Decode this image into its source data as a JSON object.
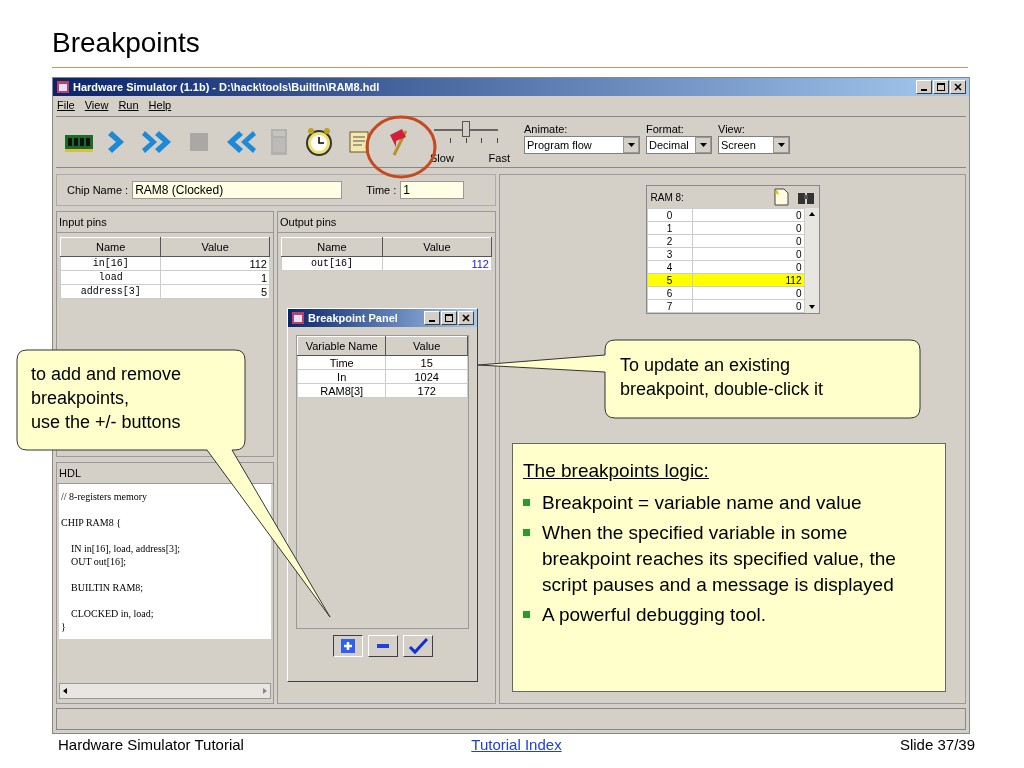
{
  "slide": {
    "title": "Breakpoints"
  },
  "window": {
    "title": "Hardware Simulator (1.1b) - D:\\hack\\tools\\BuiltIn\\RAM8.hdl"
  },
  "menu": [
    {
      "label": "File"
    },
    {
      "label": "View"
    },
    {
      "label": "Run"
    },
    {
      "label": "Help"
    }
  ],
  "toolbar": {
    "buttons": [
      {
        "kind": "chip",
        "disabled": false
      },
      {
        "kind": "step",
        "disabled": false
      },
      {
        "kind": "fast_forward",
        "disabled": false
      },
      {
        "kind": "stop",
        "disabled": true
      },
      {
        "kind": "rewind",
        "disabled": false
      },
      {
        "kind": "calculator",
        "disabled": true
      },
      {
        "kind": "clock",
        "disabled": false
      },
      {
        "kind": "script",
        "disabled": false
      },
      {
        "kind": "breakpoints",
        "disabled": false
      }
    ],
    "speed": {
      "level": 0.5,
      "min_label": "Slow",
      "max_label": "Fast"
    },
    "dropdowns": [
      {
        "label": "Animate:",
        "value": "Program flow"
      },
      {
        "label": "Format:",
        "value": "Decimal"
      },
      {
        "label": "View:",
        "value": "Screen"
      }
    ]
  },
  "chip": {
    "name_label": "Chip Name :",
    "name": "RAM8 (Clocked)",
    "time_label": "Time :",
    "time": "1"
  },
  "input_pins": {
    "title": "Input pins",
    "columns": [
      "Name",
      "Value"
    ],
    "rows": [
      {
        "name": "in[16]",
        "value": "112"
      },
      {
        "name": "load",
        "value": "1"
      },
      {
        "name": "address[3]",
        "value": "5"
      }
    ]
  },
  "output_pins": {
    "title": "Output pins",
    "columns": [
      "Name",
      "Value"
    ],
    "rows": [
      {
        "name": "out[16]",
        "value": "112"
      }
    ]
  },
  "hdl": {
    "title": "HDL",
    "lines": [
      {
        "text": "// 8-registers memory",
        "indented": false,
        "gap_before": false
      },
      {
        "text": "CHIP RAM8 {",
        "indented": false,
        "gap_before": true
      },
      {
        "text": "IN in[16], load, address[3];",
        "indented": true,
        "gap_before": true
      },
      {
        "text": "OUT out[16];",
        "indented": true,
        "gap_before": false
      },
      {
        "text": "BUILTIN RAM8;",
        "indented": true,
        "gap_before": true
      },
      {
        "text": "CLOCKED in, load;",
        "indented": true,
        "gap_before": true
      },
      {
        "text": "}",
        "indented": false,
        "gap_before": false
      }
    ]
  },
  "ram": {
    "title": "RAM 8:",
    "rows": [
      {
        "address": "0",
        "value": "0",
        "selected": false
      },
      {
        "address": "1",
        "value": "0",
        "selected": false
      },
      {
        "address": "2",
        "value": "0",
        "selected": false
      },
      {
        "address": "3",
        "value": "0",
        "selected": false
      },
      {
        "address": "4",
        "value": "0",
        "selected": false
      },
      {
        "address": "5",
        "value": "112",
        "selected": true
      },
      {
        "address": "6",
        "value": "0",
        "selected": false
      },
      {
        "address": "7",
        "value": "0",
        "selected": false
      }
    ]
  },
  "breakpoint_panel": {
    "title": "Breakpoint Panel",
    "columns": [
      "Variable Name",
      "Value"
    ],
    "rows": [
      {
        "name": "Time",
        "value": "15"
      },
      {
        "name": "In",
        "value": "1024"
      },
      {
        "name": "RAM8[3]",
        "value": "172"
      }
    ],
    "buttons": [
      {
        "kind": "add"
      },
      {
        "kind": "remove"
      },
      {
        "kind": "ok"
      }
    ]
  },
  "callouts": [
    {
      "text": "to add and remove\nbreakpoints,\nuse the +/- buttons"
    },
    {
      "text": "To update an existing\nbreakpoint, double-click it"
    }
  ],
  "logic": {
    "heading": "The breakpoints logic:",
    "bullets": [
      "Breakpoint = variable name and value",
      "When the specified variable in some breakpoint reaches its specified value, the script pauses and a message is displayed",
      "A powerful debugging tool."
    ]
  },
  "footer": {
    "left": "Hardware Simulator Tutorial",
    "link": "Tutorial Index",
    "right": "Slide 37/39"
  }
}
